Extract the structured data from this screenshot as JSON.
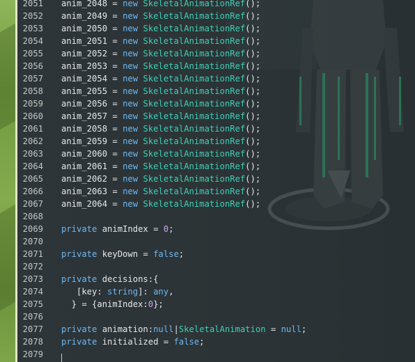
{
  "editor": {
    "lines": [
      {
        "num": "2051",
        "tokens": [
          {
            "t": "anim_2048 = ",
            "c": "plain"
          },
          {
            "t": "new",
            "c": "kw"
          },
          {
            "t": " ",
            "c": "plain"
          },
          {
            "t": "SkeletalAnimationRef",
            "c": "cls"
          },
          {
            "t": "();",
            "c": "plain"
          }
        ]
      },
      {
        "num": "2052",
        "tokens": [
          {
            "t": "anim_2049 = ",
            "c": "plain"
          },
          {
            "t": "new",
            "c": "kw"
          },
          {
            "t": " ",
            "c": "plain"
          },
          {
            "t": "SkeletalAnimationRef",
            "c": "cls"
          },
          {
            "t": "();",
            "c": "plain"
          }
        ]
      },
      {
        "num": "2053",
        "tokens": [
          {
            "t": "anim_2050 = ",
            "c": "plain"
          },
          {
            "t": "new",
            "c": "kw"
          },
          {
            "t": " ",
            "c": "plain"
          },
          {
            "t": "SkeletalAnimationRef",
            "c": "cls"
          },
          {
            "t": "();",
            "c": "plain"
          }
        ]
      },
      {
        "num": "2054",
        "tokens": [
          {
            "t": "anim_2051 = ",
            "c": "plain"
          },
          {
            "t": "new",
            "c": "kw"
          },
          {
            "t": " ",
            "c": "plain"
          },
          {
            "t": "SkeletalAnimationRef",
            "c": "cls"
          },
          {
            "t": "();",
            "c": "plain"
          }
        ]
      },
      {
        "num": "2055",
        "tokens": [
          {
            "t": "anim_2052 = ",
            "c": "plain"
          },
          {
            "t": "new",
            "c": "kw"
          },
          {
            "t": " ",
            "c": "plain"
          },
          {
            "t": "SkeletalAnimationRef",
            "c": "cls"
          },
          {
            "t": "();",
            "c": "plain"
          }
        ]
      },
      {
        "num": "2056",
        "tokens": [
          {
            "t": "anim_2053 = ",
            "c": "plain"
          },
          {
            "t": "new",
            "c": "kw"
          },
          {
            "t": " ",
            "c": "plain"
          },
          {
            "t": "SkeletalAnimationRef",
            "c": "cls"
          },
          {
            "t": "();",
            "c": "plain"
          }
        ]
      },
      {
        "num": "2057",
        "tokens": [
          {
            "t": "anim_2054 = ",
            "c": "plain"
          },
          {
            "t": "new",
            "c": "kw"
          },
          {
            "t": " ",
            "c": "plain"
          },
          {
            "t": "SkeletalAnimationRef",
            "c": "cls"
          },
          {
            "t": "();",
            "c": "plain"
          }
        ]
      },
      {
        "num": "2058",
        "tokens": [
          {
            "t": "anim_2055 = ",
            "c": "plain"
          },
          {
            "t": "new",
            "c": "kw"
          },
          {
            "t": " ",
            "c": "plain"
          },
          {
            "t": "SkeletalAnimationRef",
            "c": "cls"
          },
          {
            "t": "();",
            "c": "plain"
          }
        ]
      },
      {
        "num": "2059",
        "tokens": [
          {
            "t": "anim_2056 = ",
            "c": "plain"
          },
          {
            "t": "new",
            "c": "kw"
          },
          {
            "t": " ",
            "c": "plain"
          },
          {
            "t": "SkeletalAnimationRef",
            "c": "cls"
          },
          {
            "t": "();",
            "c": "plain"
          }
        ]
      },
      {
        "num": "2060",
        "tokens": [
          {
            "t": "anim_2057 = ",
            "c": "plain"
          },
          {
            "t": "new",
            "c": "kw"
          },
          {
            "t": " ",
            "c": "plain"
          },
          {
            "t": "SkeletalAnimationRef",
            "c": "cls"
          },
          {
            "t": "();",
            "c": "plain"
          }
        ]
      },
      {
        "num": "2061",
        "tokens": [
          {
            "t": "anim_2058 = ",
            "c": "plain"
          },
          {
            "t": "new",
            "c": "kw"
          },
          {
            "t": " ",
            "c": "plain"
          },
          {
            "t": "SkeletalAnimationRef",
            "c": "cls"
          },
          {
            "t": "();",
            "c": "plain"
          }
        ]
      },
      {
        "num": "2062",
        "tokens": [
          {
            "t": "anim_2059 = ",
            "c": "plain"
          },
          {
            "t": "new",
            "c": "kw"
          },
          {
            "t": " ",
            "c": "plain"
          },
          {
            "t": "SkeletalAnimationRef",
            "c": "cls"
          },
          {
            "t": "();",
            "c": "plain"
          }
        ]
      },
      {
        "num": "2063",
        "tokens": [
          {
            "t": "anim_2060 = ",
            "c": "plain"
          },
          {
            "t": "new",
            "c": "kw"
          },
          {
            "t": " ",
            "c": "plain"
          },
          {
            "t": "SkeletalAnimationRef",
            "c": "cls"
          },
          {
            "t": "();",
            "c": "plain"
          }
        ]
      },
      {
        "num": "2064",
        "tokens": [
          {
            "t": "anim_2061 = ",
            "c": "plain"
          },
          {
            "t": "new",
            "c": "kw"
          },
          {
            "t": " ",
            "c": "plain"
          },
          {
            "t": "SkeletalAnimationRef",
            "c": "cls"
          },
          {
            "t": "();",
            "c": "plain"
          }
        ]
      },
      {
        "num": "2065",
        "tokens": [
          {
            "t": "anim_2062 = ",
            "c": "plain"
          },
          {
            "t": "new",
            "c": "kw"
          },
          {
            "t": " ",
            "c": "plain"
          },
          {
            "t": "SkeletalAnimationRef",
            "c": "cls"
          },
          {
            "t": "();",
            "c": "plain"
          }
        ]
      },
      {
        "num": "2066",
        "tokens": [
          {
            "t": "anim_2063 = ",
            "c": "plain"
          },
          {
            "t": "new",
            "c": "kw"
          },
          {
            "t": " ",
            "c": "plain"
          },
          {
            "t": "SkeletalAnimationRef",
            "c": "cls"
          },
          {
            "t": "();",
            "c": "plain"
          }
        ]
      },
      {
        "num": "2067",
        "tokens": [
          {
            "t": "anim_2064 = ",
            "c": "plain"
          },
          {
            "t": "new",
            "c": "kw"
          },
          {
            "t": " ",
            "c": "plain"
          },
          {
            "t": "SkeletalAnimationRef",
            "c": "cls"
          },
          {
            "t": "();",
            "c": "plain"
          }
        ]
      },
      {
        "num": "2068",
        "tokens": []
      },
      {
        "num": "2069",
        "tokens": [
          {
            "t": "private",
            "c": "kw"
          },
          {
            "t": " animIndex = ",
            "c": "plain"
          },
          {
            "t": "0",
            "c": "num"
          },
          {
            "t": ";",
            "c": "plain"
          }
        ]
      },
      {
        "num": "2070",
        "tokens": []
      },
      {
        "num": "2071",
        "tokens": [
          {
            "t": "private",
            "c": "kw"
          },
          {
            "t": " keyDown = ",
            "c": "plain"
          },
          {
            "t": "false",
            "c": "kw"
          },
          {
            "t": ";",
            "c": "plain"
          }
        ]
      },
      {
        "num": "2072",
        "tokens": []
      },
      {
        "num": "2073",
        "tokens": [
          {
            "t": "private",
            "c": "kw"
          },
          {
            "t": " decisions:{",
            "c": "plain"
          }
        ]
      },
      {
        "num": "2074",
        "tokens": [
          {
            "t": "   [key: ",
            "c": "plain"
          },
          {
            "t": "string",
            "c": "kw"
          },
          {
            "t": "]: ",
            "c": "plain"
          },
          {
            "t": "any",
            "c": "kw"
          },
          {
            "t": ",",
            "c": "plain"
          }
        ]
      },
      {
        "num": "2075",
        "tokens": [
          {
            "t": "  } = {animIndex:",
            "c": "plain"
          },
          {
            "t": "0",
            "c": "num"
          },
          {
            "t": "};",
            "c": "plain"
          }
        ]
      },
      {
        "num": "2076",
        "tokens": []
      },
      {
        "num": "2077",
        "tokens": [
          {
            "t": "private",
            "c": "kw"
          },
          {
            "t": " animation:",
            "c": "plain"
          },
          {
            "t": "null",
            "c": "kw"
          },
          {
            "t": "|",
            "c": "plain"
          },
          {
            "t": "SkeletalAnimation",
            "c": "cls"
          },
          {
            "t": " = ",
            "c": "plain"
          },
          {
            "t": "null",
            "c": "kw"
          },
          {
            "t": ";",
            "c": "plain"
          }
        ]
      },
      {
        "num": "2078",
        "tokens": [
          {
            "t": "private",
            "c": "kw"
          },
          {
            "t": " initialized = ",
            "c": "plain"
          },
          {
            "t": "false",
            "c": "kw"
          },
          {
            "t": ";",
            "c": "plain"
          }
        ]
      },
      {
        "num": "2079",
        "tokens": []
      }
    ]
  },
  "colors": {
    "keyword": "#6fb8f2",
    "class_name": "#3ed0b6",
    "number": "#c9a3f0",
    "text": "#e8e8e8",
    "line_number": "#c2c8c4",
    "background": "#2a3234",
    "left_panel": "#7ea54a"
  }
}
